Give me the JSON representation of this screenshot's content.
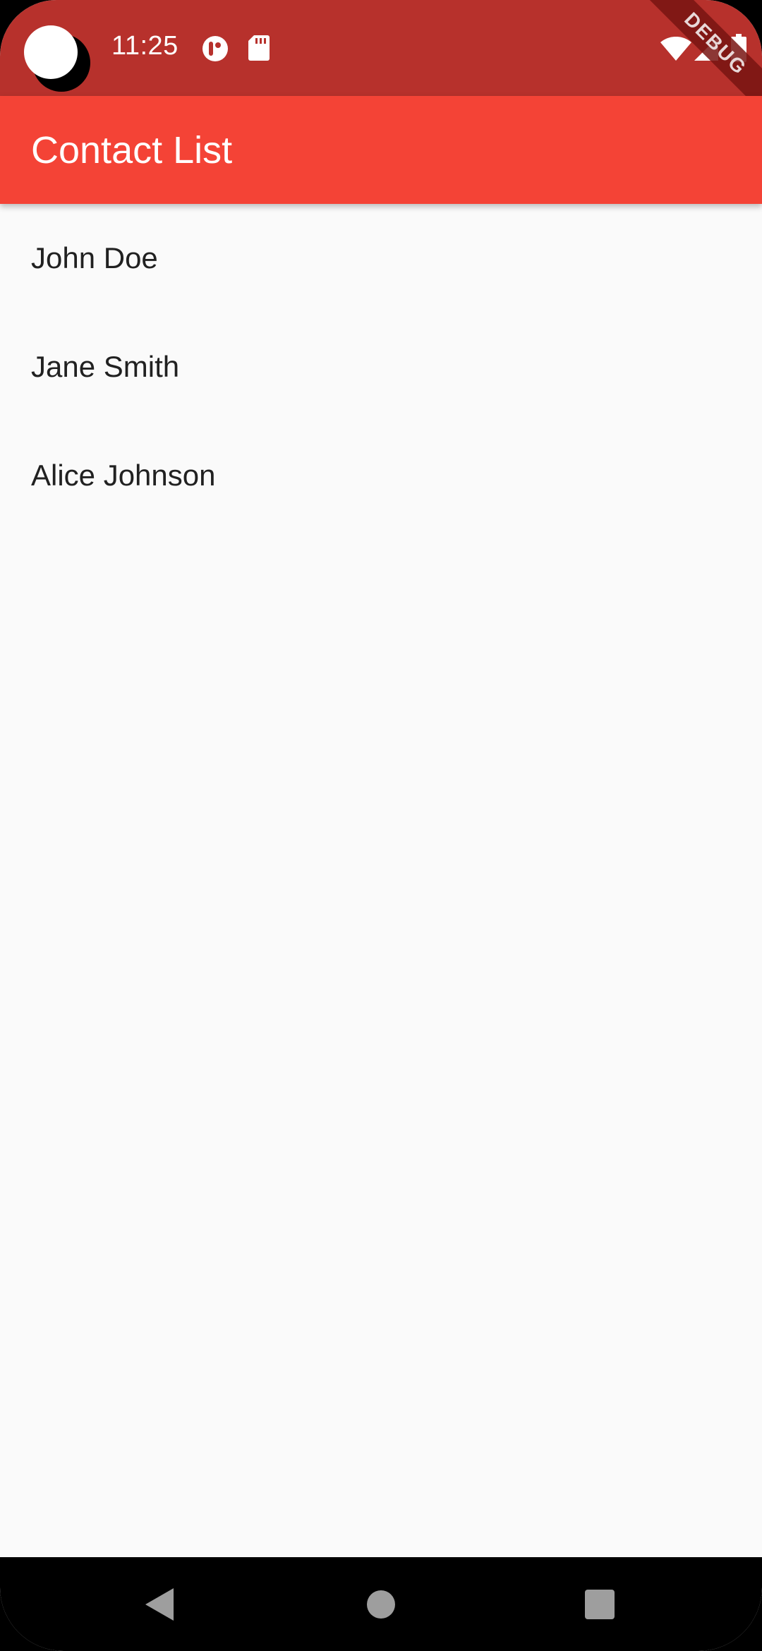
{
  "status_bar": {
    "time": "11:25",
    "debug_label": "DEBUG",
    "icons": [
      "notification-app-icon",
      "sd-card-icon",
      "wifi-icon",
      "cell-signal-icon",
      "battery-icon"
    ]
  },
  "app_bar": {
    "title": "Contact List"
  },
  "contacts": [
    {
      "name": "John Doe"
    },
    {
      "name": "Jane Smith"
    },
    {
      "name": "Alice Johnson"
    }
  ],
  "nav_bar": {
    "buttons": [
      "back-icon",
      "home-icon",
      "recents-icon"
    ]
  },
  "colors": {
    "status_bar": "#B7312C",
    "app_bar": "#F44336",
    "background": "#FAFAFA",
    "text_primary": "#212121",
    "nav_bar": "#000000"
  }
}
